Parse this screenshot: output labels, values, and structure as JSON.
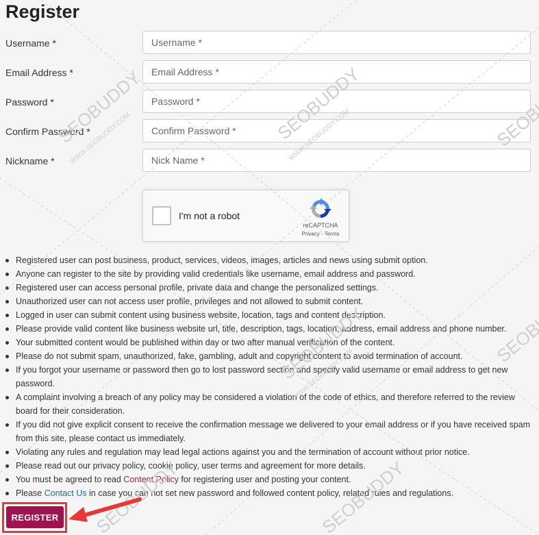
{
  "page": {
    "title": "Register"
  },
  "form": {
    "fields": [
      {
        "label": "Username *",
        "placeholder": "Username *",
        "value": ""
      },
      {
        "label": "Email Address *",
        "placeholder": "Email Address *",
        "value": ""
      },
      {
        "label": "Password *",
        "placeholder": "Password *",
        "value": ""
      },
      {
        "label": "Confirm Password *",
        "placeholder": "Confirm Password *",
        "value": ""
      },
      {
        "label": "Nickname *",
        "placeholder": "Nick Name *",
        "value": ""
      }
    ]
  },
  "captcha": {
    "label": "I'm not a robot",
    "brand": "reCAPTCHA",
    "privacy": "Privacy",
    "separator": " - ",
    "terms": "Terms",
    "logo_icon": "recaptcha-icon",
    "checked": false
  },
  "rules": [
    "Registered user can post business, product, services, videos, images, articles and news using submit option.",
    "Anyone can register to the site by providing valid credentials like username, email address and password.",
    "Registered user can access personal profile, private data and change the personalized settings.",
    "Unauthorized user can not access user profile, privileges and not allowed to submit content.",
    "Logged in user can submit content using business website, location, tags and content description.",
    "Please provide valid content like business website url, title, description, tags, location, address, email address and phone number.",
    "Your submitted content would be published within day or two after manual verification of the content.",
    "Please do not submit spam, unauthorized, fake, gambling, adult and copyright content to avoid termination of account.",
    "If you forgot your username or password then go to lost password section and specify valid username or email address to get new password.",
    "A complaint involving a breach of any policy may be considered a violation of the code of ethics, and therefore referred to the review board for their consideration.",
    "If you did not give explicit consent to receive the confirmation message we delivered to your email address or if you have received spam from this site, please contact us immediately.",
    "Violating any rules and regulation may lead legal actions against you and the termination of account without prior notice.",
    "Please read out our privacy policy, cookie policy, user terms and agreement for more details."
  ],
  "rule_policy": {
    "before": "You must be agreed to read ",
    "link": "Content Policy",
    "after": " for registering user and posting your content."
  },
  "rule_contact": {
    "before": "Please ",
    "link": "Contact Us",
    "after": " in case you can not set new password and followed content policy, related rules and regulations."
  },
  "register_button": {
    "label": "REGISTER"
  },
  "watermark": {
    "text": "SEOBUDDY",
    "subtext": "WWW.SEOBUDDY.COM"
  },
  "colors": {
    "background": "#f5f5f5",
    "button": "#9e1450",
    "link_red": "#b71c3c",
    "link_blue": "#1a6aa8",
    "highlight": "#e53935"
  }
}
